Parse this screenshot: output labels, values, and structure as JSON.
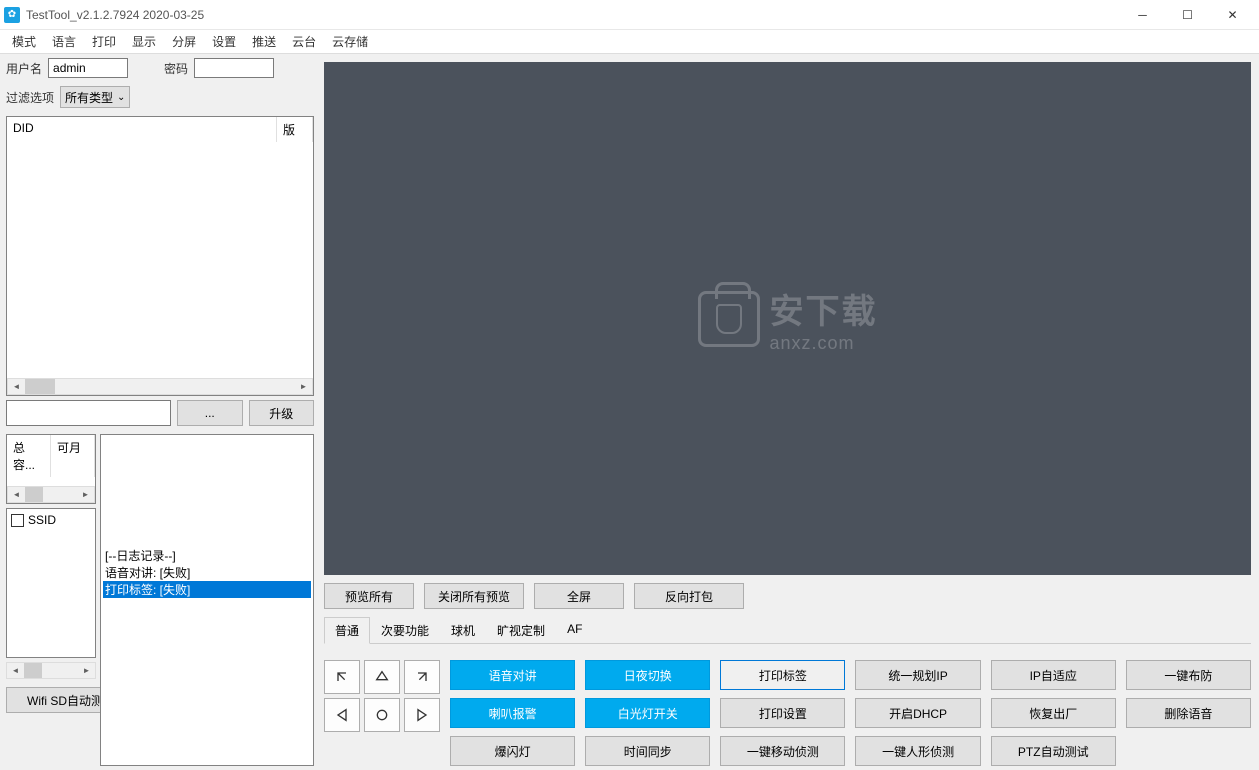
{
  "window": {
    "title": "TestTool_v2.1.2.7924 2020-03-25"
  },
  "menu": [
    "模式",
    "语言",
    "打印",
    "显示",
    "分屏",
    "设置",
    "推送",
    "云台",
    "云存储"
  ],
  "auth": {
    "user_label": "用户名",
    "user_value": "admin",
    "pass_label": "密码",
    "pass_value": "",
    "filter_label": "过滤选项",
    "filter_value": "所有类型"
  },
  "devlist": {
    "col_did": "DID",
    "col_ver": "版"
  },
  "upgrade": {
    "browse": "...",
    "btn": "升级",
    "path": ""
  },
  "capacity": {
    "total_label": "总容...",
    "avail_label": "可月"
  },
  "ssid": {
    "label": "SSID"
  },
  "wifi_btn": "Wifi SD自动测试",
  "log": {
    "lines": [
      "[--日志记录--]",
      "语音对讲: [失败]",
      "打印标签: [失败]"
    ],
    "selected": 2
  },
  "watermark": {
    "text_cn": "安下载",
    "text_en": "anxz.com"
  },
  "actions": [
    "预览所有",
    "关闭所有预览",
    "全屏",
    "反向打包"
  ],
  "tabs": [
    "普通",
    "次要功能",
    "球机",
    "旷视定制",
    "AF"
  ],
  "tab_active": 0,
  "buttons": [
    {
      "label": "语音对讲",
      "style": "blue"
    },
    {
      "label": "日夜切换",
      "style": "blue"
    },
    {
      "label": "打印标签",
      "style": "outline"
    },
    {
      "label": "统一规划IP",
      "style": ""
    },
    {
      "label": "IP自适应",
      "style": ""
    },
    {
      "label": "一键布防",
      "style": ""
    },
    {
      "label": "喇叭报警",
      "style": "blue"
    },
    {
      "label": "白光灯开关",
      "style": "blue"
    },
    {
      "label": "打印设置",
      "style": ""
    },
    {
      "label": "开启DHCP",
      "style": ""
    },
    {
      "label": "恢复出厂",
      "style": ""
    },
    {
      "label": "删除语音",
      "style": ""
    },
    {
      "label": "爆闪灯",
      "style": ""
    },
    {
      "label": "时间同步",
      "style": ""
    },
    {
      "label": "一键移动侦测",
      "style": ""
    },
    {
      "label": "一键人形侦测",
      "style": ""
    },
    {
      "label": "PTZ自动测试",
      "style": ""
    },
    {
      "label": "",
      "style": "hidden"
    }
  ]
}
